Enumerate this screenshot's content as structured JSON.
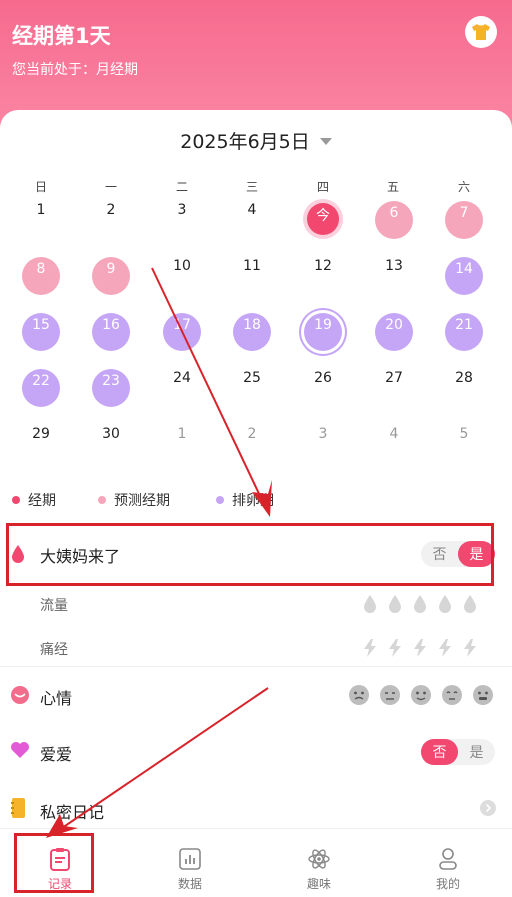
{
  "header": {
    "title": "经期第1天",
    "subtitle": "您当前处于：月经期"
  },
  "calendar": {
    "date": "2025年6月5日",
    "weekdays": [
      "日",
      "一",
      "二",
      "三",
      "四",
      "五",
      "六"
    ],
    "days": [
      "1",
      "2",
      "3",
      "4",
      "今",
      "6",
      "7",
      "8",
      "9",
      "10",
      "11",
      "12",
      "13",
      "14",
      "15",
      "16",
      "17",
      "18",
      "19",
      "20",
      "21",
      "22",
      "23",
      "24",
      "25",
      "26",
      "27",
      "28",
      "29",
      "30",
      "1",
      "2",
      "3",
      "4",
      "5"
    ]
  },
  "legend": {
    "items": [
      {
        "label": "经期",
        "color": "#f2476f"
      },
      {
        "label": "预测经期",
        "color": "#f6a6bb"
      },
      {
        "label": "排卵期",
        "color": "#c5a5f5"
      }
    ]
  },
  "records": {
    "period_label": "大姨妈来了",
    "no": "否",
    "yes": "是",
    "flow_label": "流量",
    "pain_label": "痛经",
    "mood_label": "心情",
    "love_label": "爱爱",
    "diary_label": "私密日记"
  },
  "nav": {
    "items": [
      "记录",
      "数据",
      "趣味",
      "我的"
    ],
    "active": "记录"
  },
  "colors": {
    "accent": "#f2476f",
    "annotation": "#d8232a"
  }
}
